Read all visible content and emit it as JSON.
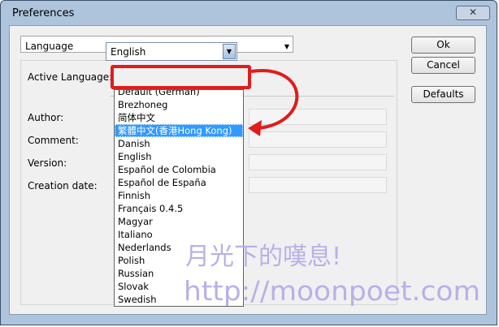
{
  "window": {
    "title": "Preferences",
    "close_glyph": "✕"
  },
  "section_combo": {
    "value": "Language",
    "arrow": "▼"
  },
  "buttons": {
    "ok": "Ok",
    "cancel": "Cancel",
    "defaults": "Defaults"
  },
  "labels": {
    "active_language": "Active Language:",
    "author": "Author:",
    "comment": "Comment:",
    "version": "Version:",
    "creation_date": "Creation date:"
  },
  "active_language": {
    "value": "English",
    "arrow": "▼"
  },
  "languages": [
    "Default (German)",
    "Brezhoneg",
    "简体中文",
    "繁體中文(香港Hong Kong)",
    "Danish",
    "English",
    "Español de Colombia",
    "Español de España",
    "Finnish",
    "Français 0.4.5",
    "Magyar",
    "Italiano",
    "Nederlands",
    "Polish",
    "Russian",
    "Slovak",
    "Swedish"
  ],
  "selected_language_index": 3,
  "watermark": {
    "line1": "月光下的嘆息!",
    "line2": "http://moonpoet.com"
  },
  "colors": {
    "annotation_red": "#e01c1c",
    "selection_blue": "#3399ff",
    "watermark": "#b8b0e8"
  }
}
